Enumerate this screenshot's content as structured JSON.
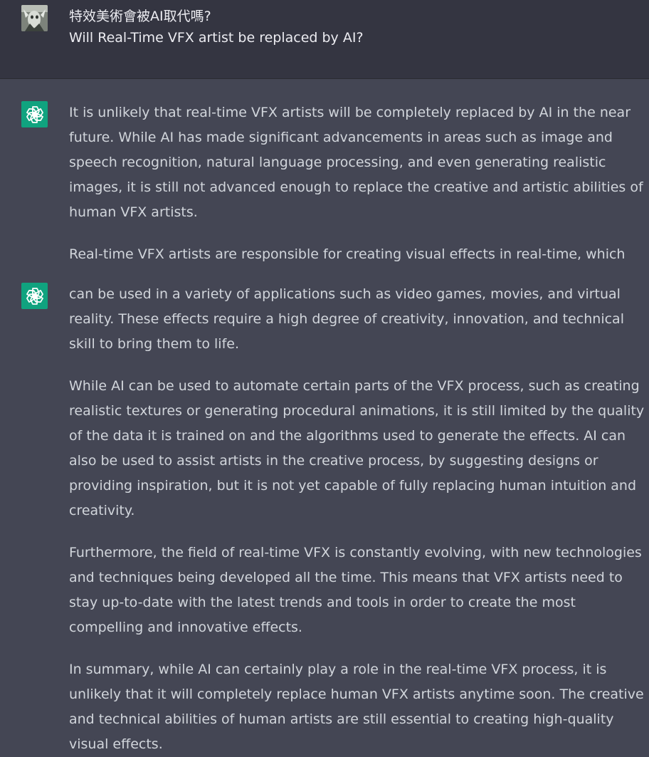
{
  "user": {
    "line1": "特效美術會被AI取代嗎?",
    "line2": "Will Real-Time VFX artist be replaced by AI?"
  },
  "assistant_1": {
    "paragraphs": [
      "It is unlikely that real-time VFX artists will be completely replaced by AI in the near future. While AI has made significant advancements in areas such as image and speech recognition, natural language processing, and even generating realistic images, it is still not advanced enough to replace the creative and artistic abilities of human VFX artists.",
      "Real-time VFX artists are responsible for creating visual effects in real-time, which"
    ]
  },
  "assistant_2": {
    "paragraphs": [
      "can be used in a variety of applications such as video games, movies, and virtual reality. These effects require a high degree of creativity, innovation, and technical skill to bring them to life.",
      "While AI can be used to automate certain parts of the VFX process, such as creating realistic textures or generating procedural animations, it is still limited by the quality of the data it is trained on and the algorithms used to generate the effects. AI can also be used to assist artists in the creative process, by suggesting designs or providing inspiration, but it is not yet capable of fully replacing human intuition and creativity.",
      "Furthermore, the field of real-time VFX is constantly evolving, with new technologies and techniques being developed all the time. This means that VFX artists need to stay up-to-date with the latest trends and tools in order to create the most compelling and innovative effects.",
      "In summary, while AI can certainly play a role in the real-time VFX process, it is unlikely that it will completely replace human VFX artists anytime soon. The creative and technical abilities of human artists are still essential to creating high-quality visual effects."
    ]
  },
  "icons": {
    "user_avatar": "user-avatar-photo",
    "assistant_avatar": "openai-logo-icon"
  },
  "colors": {
    "user_bg": "#343541",
    "assistant_bg": "#444654",
    "avatar_green": "#10a37f",
    "text": "#d1d5db"
  }
}
